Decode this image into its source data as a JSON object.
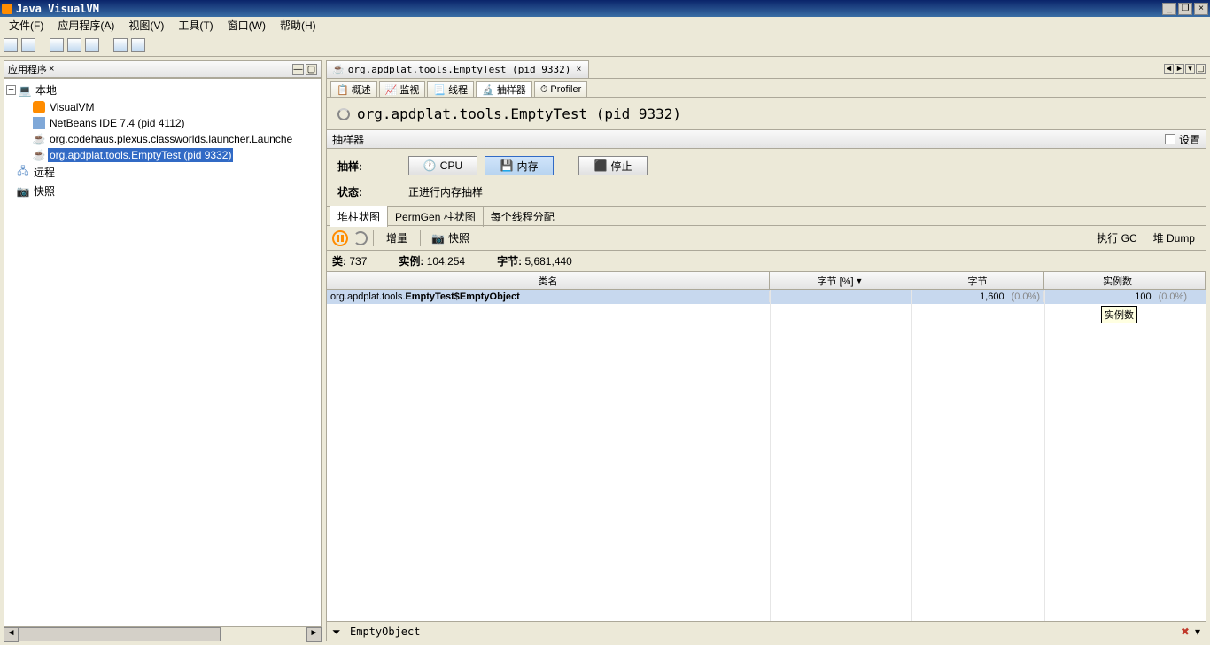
{
  "window": {
    "title": "Java VisualVM"
  },
  "menubar": [
    "文件(F)",
    "应用程序(A)",
    "视图(V)",
    "工具(T)",
    "窗口(W)",
    "帮助(H)"
  ],
  "sidebar": {
    "header": "应用程序",
    "root": "本地",
    "items": [
      {
        "label": "VisualVM",
        "icon": "vvim"
      },
      {
        "label": "NetBeans IDE 7.4 (pid 4112)",
        "icon": "nb"
      },
      {
        "label": "org.codehaus.plexus.classworlds.launcher.Launche",
        "icon": "java"
      },
      {
        "label": "org.apdplat.tools.EmptyTest (pid 9332)",
        "icon": "java",
        "selected": true
      }
    ],
    "extra": [
      "远程",
      "快照"
    ]
  },
  "mainTab": {
    "label": "org.apdplat.tools.EmptyTest (pid 9332)"
  },
  "subtabs": [
    {
      "label": "概述"
    },
    {
      "label": "监视"
    },
    {
      "label": "线程"
    },
    {
      "label": "抽样器",
      "active": true
    },
    {
      "label": "Profiler"
    }
  ],
  "pageTitle": "org.apdplat.tools.EmptyTest (pid 9332)",
  "panel": {
    "title": "抽样器",
    "settingLabel": "设置"
  },
  "controls": {
    "sampleLabel": "抽样:",
    "cpuBtn": "CPU",
    "memBtn": "内存",
    "stopBtn": "停止",
    "statusLabel": "状态:",
    "statusText": "正进行内存抽样"
  },
  "subsubtabs": [
    "堆柱状图",
    "PermGen 柱状图",
    "每个线程分配"
  ],
  "ctrlbar": {
    "deltaLabel": "增量",
    "snapshotLabel": "快照",
    "gcLabel": "执行 GC",
    "dumpLabel": "堆 Dump"
  },
  "stats": {
    "classesLabel": "类:",
    "classes": "737",
    "instancesLabel": "实例:",
    "instances": "104,254",
    "bytesLabel": "字节:",
    "bytes": "5,681,440"
  },
  "table": {
    "headers": [
      "类名",
      "字节 [%]",
      "字节",
      "实例数"
    ],
    "row": {
      "name_prefix": "org.apdplat.tools.",
      "name_bold": "EmptyTest$EmptyObject",
      "bytes": "1,600",
      "bytesPct": "(0.0%)",
      "instances": "100",
      "instancesPct": "(0.0%)"
    },
    "tooltip": "实例数"
  },
  "footer": {
    "filterText": "EmptyObject"
  }
}
